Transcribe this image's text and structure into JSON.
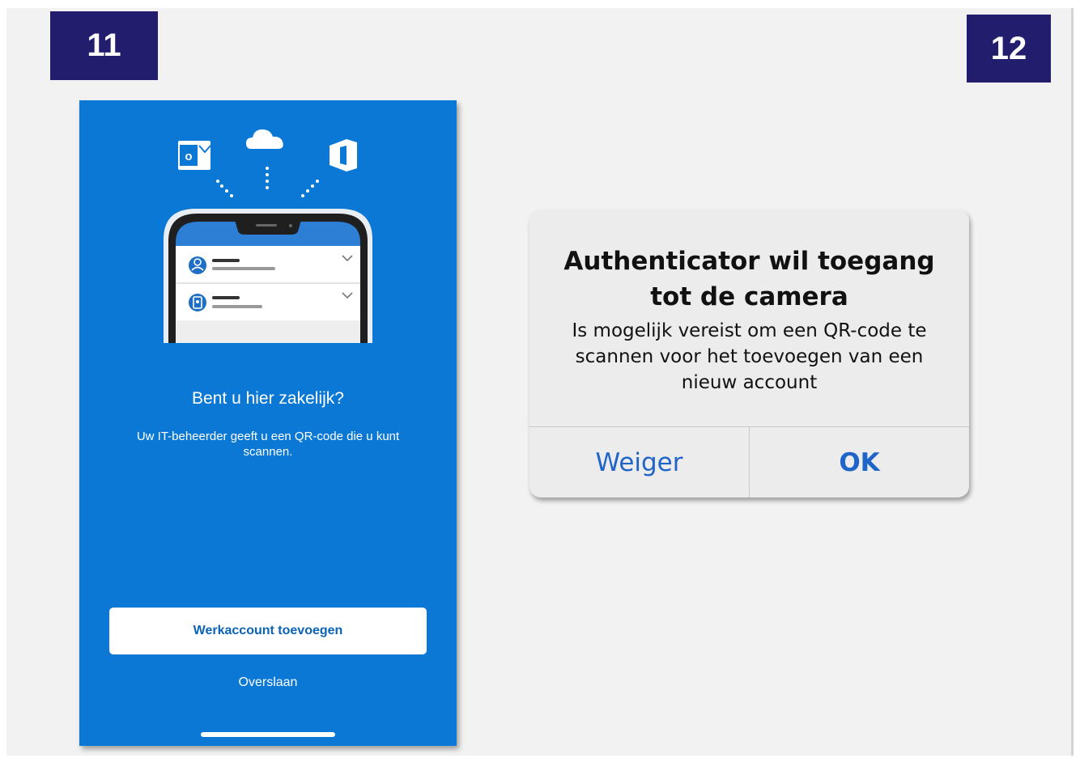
{
  "steps": {
    "left": "11",
    "right": "12"
  },
  "onboarding": {
    "title": "Bent u hier zakelijk?",
    "subtitle": "Uw IT-beheerder geeft u een QR-code die u kunt scannen.",
    "primary_button": "Werkaccount toevoegen",
    "skip_link": "Overslaan",
    "icons": [
      "outlook-icon",
      "onedrive-cloud-icon",
      "office-icon",
      "phone-illustration",
      "person-icon",
      "badge-icon",
      "chevron-down-icon"
    ]
  },
  "permission_dialog": {
    "title": "Authenticator wil toegang tot de camera",
    "message": "Is mogelijk vereist om een QR-code te scannen voor het toevoegen van een nieuw account",
    "deny_button": "Weiger",
    "ok_button": "OK"
  },
  "colors": {
    "badge": "#231d6e",
    "phone_background": "#0b78d6",
    "button_text": "#0b63b8",
    "dialog_background": "#ececec",
    "dialog_action": "#1f64c8"
  }
}
